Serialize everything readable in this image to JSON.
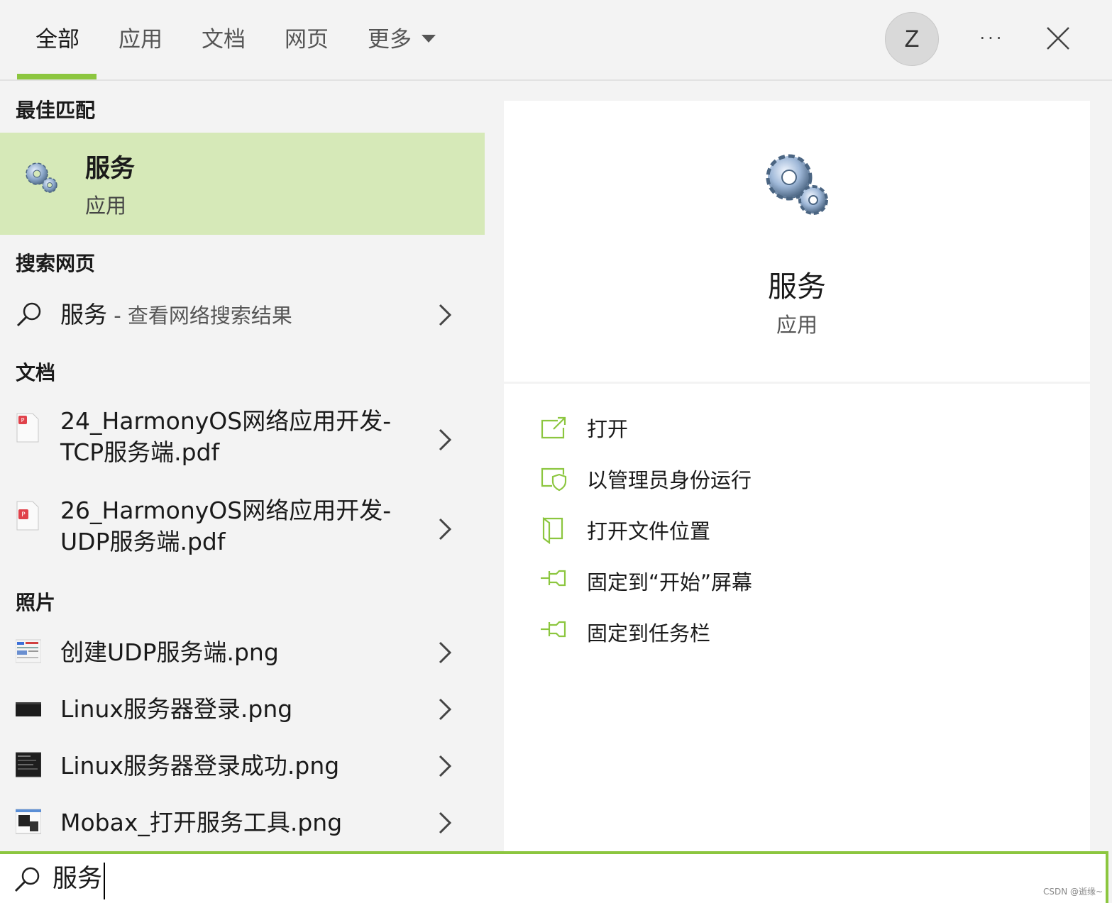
{
  "tabs": [
    {
      "label": "全部",
      "active": true
    },
    {
      "label": "应用"
    },
    {
      "label": "文档"
    },
    {
      "label": "网页"
    },
    {
      "label": "更多"
    }
  ],
  "accent_color": "#8cc63f",
  "avatar_initial": "Z",
  "more_label": "···",
  "sections": {
    "best_match": "最佳匹配",
    "web": "搜索网页",
    "documents": "文档",
    "photos": "照片"
  },
  "best_match": {
    "title": "服务",
    "subtitle": "应用",
    "icon": "services-gear-icon"
  },
  "web_result": {
    "query": "服务",
    "suffix": " - 查看网络搜索结果"
  },
  "documents": [
    {
      "line1": "24_HarmonyOS网络应用开发-",
      "line2": "TCP服务端.pdf",
      "icon": "pdf-file-icon"
    },
    {
      "line1": "26_HarmonyOS网络应用开发-",
      "line2": "UDP服务端.pdf",
      "icon": "pdf-file-icon"
    }
  ],
  "photos": [
    {
      "name": "创建UDP服务端.png",
      "icon": "image-thumbnail-icon"
    },
    {
      "name": "Linux服务器登录.png",
      "icon": "image-thumbnail-icon"
    },
    {
      "name": "Linux服务器登录成功.png",
      "icon": "image-thumbnail-icon"
    },
    {
      "name": "Mobax_打开服务工具.png",
      "icon": "image-thumbnail-icon"
    }
  ],
  "detail": {
    "name": "服务",
    "type": "应用"
  },
  "actions": [
    {
      "label": "打开",
      "icon": "open-icon"
    },
    {
      "label": "以管理员身份运行",
      "icon": "run-as-admin-icon"
    },
    {
      "label": "打开文件位置",
      "icon": "file-location-icon"
    },
    {
      "label": "固定到“开始”屏幕",
      "icon": "pin-icon"
    },
    {
      "label": "固定到任务栏",
      "icon": "pin-icon"
    }
  ],
  "search": {
    "value": "服务"
  },
  "watermark": "CSDN @逝缘~"
}
